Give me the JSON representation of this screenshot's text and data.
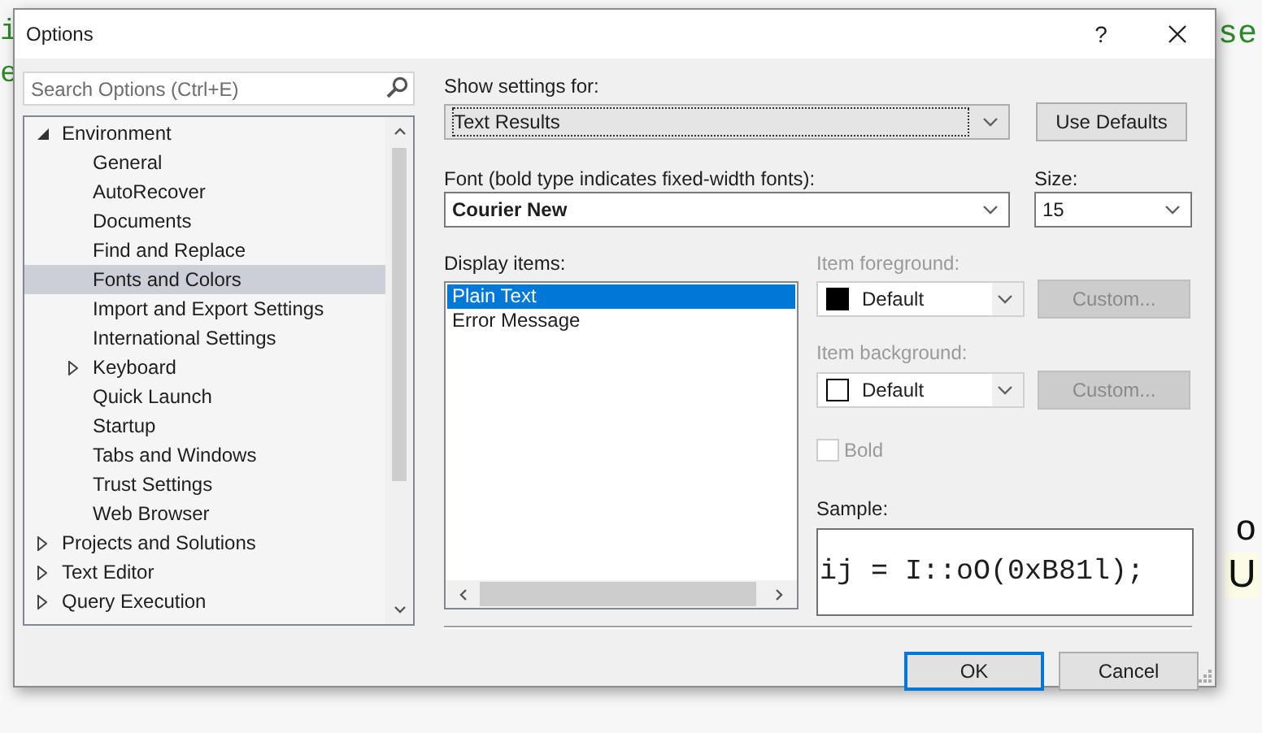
{
  "background_text": [
    "i",
    "e",
    "se",
    "o",
    "U"
  ],
  "window": {
    "title": "Options",
    "help": "?"
  },
  "search": {
    "placeholder": "Search Options (Ctrl+E)"
  },
  "tree": [
    {
      "label": "Environment",
      "expanded": true,
      "selected": false,
      "children": [
        {
          "label": "General",
          "selected": false
        },
        {
          "label": "AutoRecover",
          "selected": false
        },
        {
          "label": "Documents",
          "selected": false
        },
        {
          "label": "Find and Replace",
          "selected": false
        },
        {
          "label": "Fonts and Colors",
          "selected": true
        },
        {
          "label": "Import and Export Settings",
          "selected": false
        },
        {
          "label": "International Settings",
          "selected": false
        },
        {
          "label": "Keyboard",
          "expanded": false,
          "selected": false
        },
        {
          "label": "Quick Launch",
          "selected": false
        },
        {
          "label": "Startup",
          "selected": false
        },
        {
          "label": "Tabs and Windows",
          "selected": false
        },
        {
          "label": "Trust Settings",
          "selected": false
        },
        {
          "label": "Web Browser",
          "selected": false
        }
      ]
    },
    {
      "label": "Projects and Solutions",
      "expanded": false,
      "selected": false
    },
    {
      "label": "Text Editor",
      "expanded": false,
      "selected": false
    },
    {
      "label": "Query Execution",
      "expanded": false,
      "selected": false
    }
  ],
  "show_settings": {
    "label": "Show settings for:",
    "value": "Text Results"
  },
  "use_defaults": "Use Defaults",
  "font": {
    "label": "Font (bold type indicates fixed-width fonts):",
    "value": "Courier New"
  },
  "size": {
    "label": "Size:",
    "value": "15"
  },
  "display_items": {
    "label": "Display items:",
    "items": [
      {
        "label": "Plain Text",
        "selected": true
      },
      {
        "label": "Error Message",
        "selected": false
      }
    ]
  },
  "foreground": {
    "label": "Item foreground:",
    "value": "Default",
    "color": "#000000",
    "disabled": true,
    "button": "Custom..."
  },
  "background": {
    "label": "Item background:",
    "value": "Default",
    "color": "#ffffff",
    "disabled": true,
    "button": "Custom..."
  },
  "bold": {
    "label": "Bold",
    "checked": false,
    "disabled": true
  },
  "sample": {
    "label": "Sample:",
    "text": "ij = I::oO(0xB81l);"
  },
  "buttons": [
    {
      "label": "OK",
      "default": true
    },
    {
      "label": "Cancel",
      "default": false
    }
  ]
}
